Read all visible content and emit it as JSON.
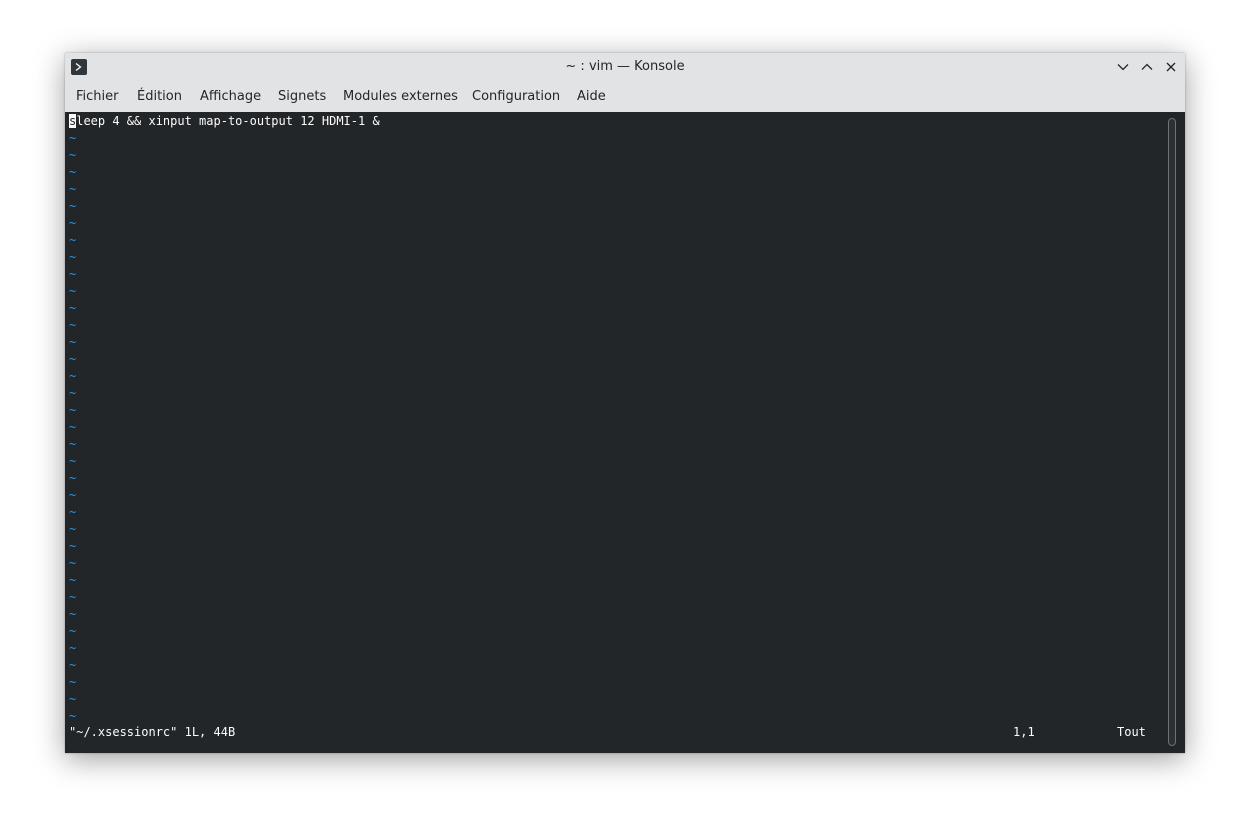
{
  "window": {
    "title": "~ : vim — Konsole",
    "icon": "konsole-terminal-icon"
  },
  "window_controls": {
    "minimize_icon": "chevron-down-icon",
    "maximize_icon": "chevron-up-icon",
    "close_icon": "close-x-icon"
  },
  "menubar": {
    "items": [
      {
        "label": "Fichier"
      },
      {
        "label": "Édition"
      },
      {
        "label": "Affichage"
      },
      {
        "label": "Signets"
      },
      {
        "label": "Modules externes"
      },
      {
        "label": "Configuration"
      },
      {
        "label": "Aide"
      }
    ]
  },
  "editor": {
    "cursor_char": "s",
    "line1_rest": "leep 4 && xinput map-to-output 12 HDMI-1 &",
    "empty_line_marker": "~",
    "empty_line_count": 35
  },
  "statusline": {
    "file_info": "\"~/.xsessionrc\" 1L, 44B",
    "position": "1,1",
    "scroll": "Tout"
  },
  "colors": {
    "terminal_bg": "#232629",
    "terminal_fg": "#fcfcfc",
    "tilde": "#1d99f3",
    "chrome_bg": "#e2e3e4"
  }
}
